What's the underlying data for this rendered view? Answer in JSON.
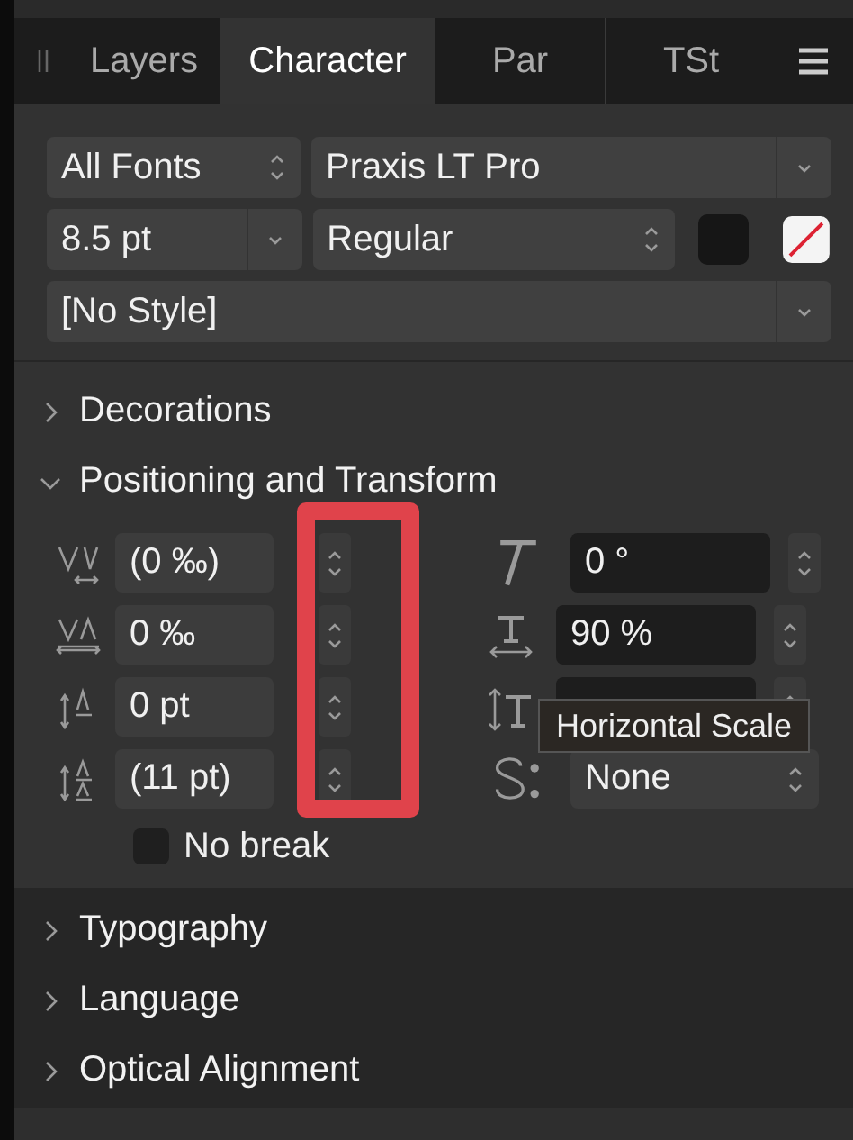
{
  "tabs": [
    {
      "label": "Layers",
      "selected": false
    },
    {
      "label": "Character",
      "selected": true
    },
    {
      "label": "Par",
      "selected": false
    },
    {
      "label": "TSt",
      "selected": false
    }
  ],
  "font_collection": {
    "value": "All Fonts"
  },
  "font_family": {
    "value": "Praxis LT Pro"
  },
  "font_size": {
    "value": "8.5 pt"
  },
  "font_style": {
    "value": "Regular"
  },
  "character_style": {
    "value": "[No Style]"
  },
  "sections_top": [
    {
      "label": "Decorations",
      "expanded": false
    },
    {
      "label": "Positioning and Transform",
      "expanded": true
    }
  ],
  "positioning": {
    "left_fields": [
      {
        "kind": "tracking",
        "value": "(0 ‰)"
      },
      {
        "kind": "kerning",
        "value": "0 ‰"
      },
      {
        "kind": "baseline",
        "value": "0 pt"
      },
      {
        "kind": "leading",
        "value": "(11 pt)"
      }
    ],
    "right_fields": [
      {
        "kind": "skew",
        "value": "0 °"
      },
      {
        "kind": "hscale",
        "value": "90 %"
      },
      {
        "kind": "vscale"
      },
      {
        "kind": "select",
        "value": "None"
      }
    ],
    "no_break": {
      "label": "No break",
      "checked": false
    }
  },
  "sections_bottom": [
    {
      "label": "Typography",
      "expanded": false
    },
    {
      "label": "Language",
      "expanded": false
    },
    {
      "label": "Optical Alignment",
      "expanded": false
    }
  ],
  "tooltip": {
    "text": "Horizontal Scale"
  },
  "highlight": {
    "kind": "rectangle"
  }
}
